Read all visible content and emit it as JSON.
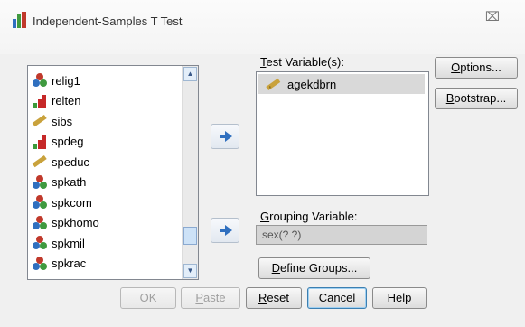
{
  "window": {
    "title": "Independent-Samples T Test",
    "close_label": "⌧"
  },
  "source_list": {
    "items": [
      {
        "label": "relig1",
        "icon": "nominal-icon"
      },
      {
        "label": "relten",
        "icon": "ordinal-icon"
      },
      {
        "label": "sibs",
        "icon": "scale-icon"
      },
      {
        "label": "spdeg",
        "icon": "ordinal-icon"
      },
      {
        "label": "speduc",
        "icon": "scale-icon"
      },
      {
        "label": "spkath",
        "icon": "nominal-icon"
      },
      {
        "label": "spkcom",
        "icon": "nominal-icon"
      },
      {
        "label": "spkhomo",
        "icon": "nominal-icon"
      },
      {
        "label": "spkmil",
        "icon": "nominal-icon"
      },
      {
        "label": "spkrac",
        "icon": "nominal-icon"
      }
    ]
  },
  "test_variables": {
    "label_prefix": "",
    "label_u": "T",
    "label_rest": "est Variable(s):",
    "items": [
      {
        "label": "agekdbrn",
        "icon": "scale-icon"
      }
    ]
  },
  "grouping": {
    "label_prefix": "",
    "label_u": "G",
    "label_rest": "rouping Variable:",
    "value": "sex(? ?)"
  },
  "side_buttons": {
    "options_u": "O",
    "options_rest": "ptions...",
    "bootstrap_u": "B",
    "bootstrap_rest": "ootstrap..."
  },
  "define_groups": {
    "label_u": "D",
    "label_rest": "efine Groups..."
  },
  "bottom_buttons": {
    "ok": "OK",
    "paste_u": "P",
    "paste_rest": "aste",
    "reset_u": "R",
    "reset_rest": "eset",
    "cancel": "Cancel",
    "help": "Help"
  },
  "colors": {
    "nominal_red": "#c0392b",
    "nominal_blue": "#2f6fbf",
    "nominal_green": "#3f9a3f",
    "ordinal_red": "#c62828",
    "ordinal_green": "#3a9a3a",
    "scale_ruler": "#c9a23c"
  }
}
